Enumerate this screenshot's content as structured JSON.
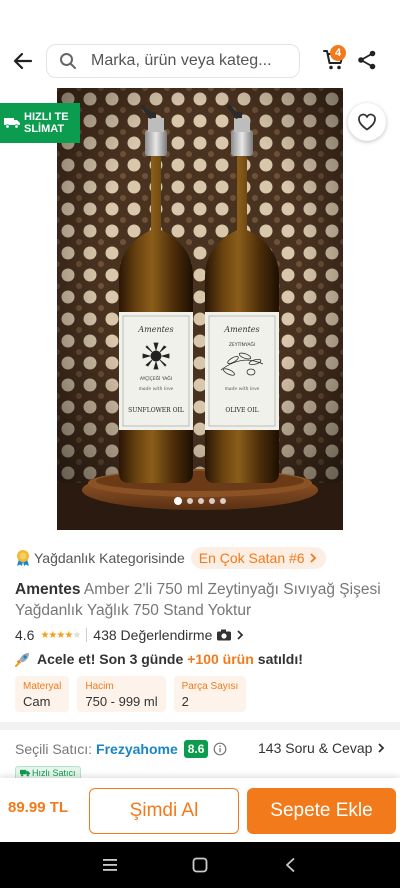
{
  "search": {
    "placeholder": "Marka, ürün veya kateg..."
  },
  "cart": {
    "count": "4"
  },
  "gallery": {
    "badge_line1": "HIZLI TE",
    "badge_line2": "SLİMAT",
    "image_count": 5,
    "active_index": 0,
    "bottle_left_label": {
      "script": "Amentes",
      "name": "AYÇİÇEĞİ YAĞI",
      "tagline": "made with love",
      "bottom": "SUNFLOWER OIL"
    },
    "bottle_right_label": {
      "script": "Amentes",
      "name": "ZEYTİNYAĞI",
      "tagline": "made with love",
      "bottom": "OLIVE OIL"
    }
  },
  "category": {
    "prefix": "Yağdanlık Kategorisinde",
    "rank": "En Çok Satan #6"
  },
  "product": {
    "brand": "Amentes",
    "name": "Amber 2'li 750 ml Zeytinyağı Sıvıyağ Şişesi Yağdanlık Yağlık 750 Stand Yoktur",
    "rating": "4.6",
    "stars": 4.6,
    "reviews": "438 Değerlendirme"
  },
  "urgency": {
    "prefix": "Acele et! Son 3 günde",
    "highlight": "+100 ürün",
    "suffix": "satıldı!"
  },
  "attributes": [
    {
      "key": "Materyal",
      "value": "Cam"
    },
    {
      "key": "Hacim",
      "value": "750 - 999 ml"
    },
    {
      "key": "Parça Sayısı",
      "value": "2"
    }
  ],
  "seller": {
    "label": "Seçili Satıcı:",
    "name": "Frezyahome",
    "score": "8.6",
    "fast_badge": "Hızlı Satıcı",
    "qa": "143 Soru & Cevap"
  },
  "bottom": {
    "price": "89.99 TL",
    "buy_now": "Şimdi Al",
    "add_to_cart": "Sepete Ekle"
  },
  "colors": {
    "accent": "#f27a1a",
    "success": "#0c9c4f",
    "link": "#1b84c6"
  },
  "icons": [
    "back-arrow-icon",
    "search-icon",
    "cart-icon",
    "share-icon",
    "truck-icon",
    "heart-icon",
    "medal-icon",
    "chevron-right-icon",
    "camera-icon",
    "rocket-icon",
    "info-icon",
    "menu-icon",
    "home-square-icon",
    "back-triangle-icon"
  ]
}
